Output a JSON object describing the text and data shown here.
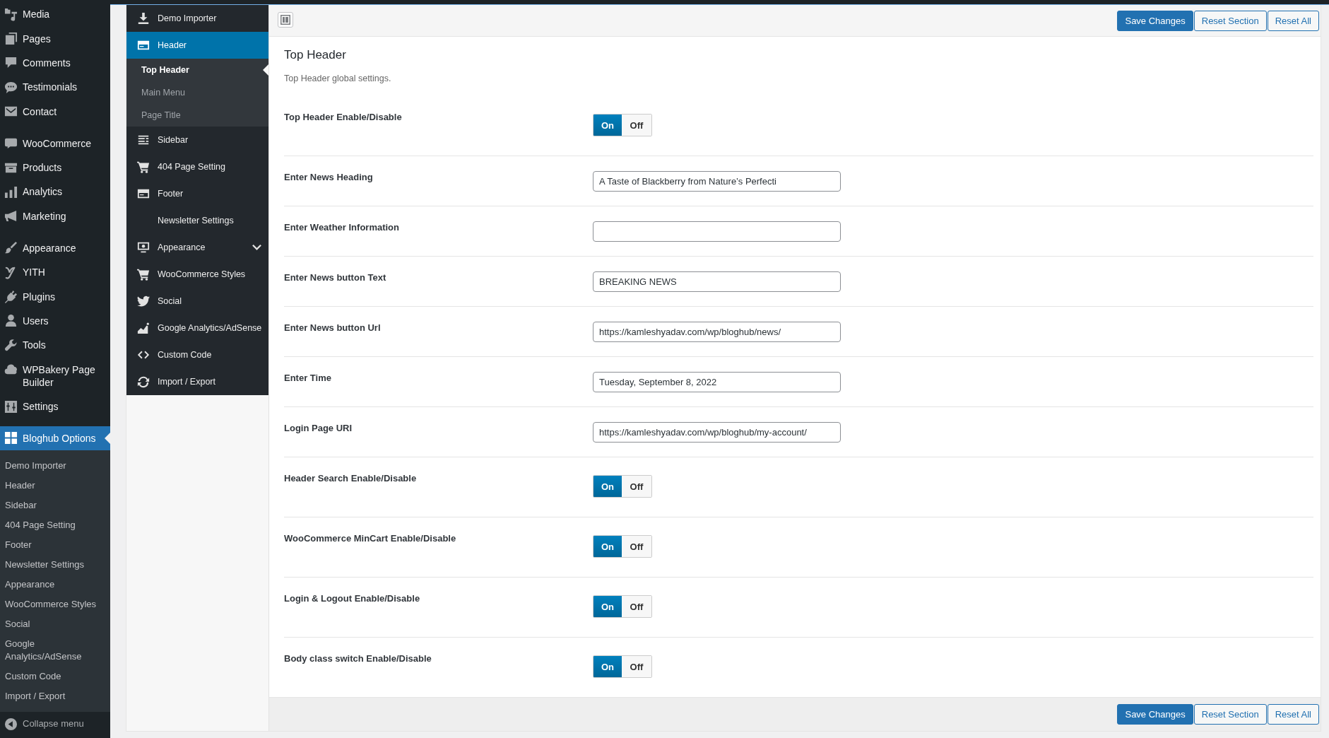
{
  "admin_menu": {
    "groups": [
      {
        "items": [
          {
            "label": "Media",
            "selected": false
          },
          {
            "label": "Pages",
            "selected": false
          },
          {
            "label": "Comments",
            "selected": false
          },
          {
            "label": "Testimonials",
            "selected": false
          },
          {
            "label": "Contact",
            "selected": false
          }
        ]
      },
      {
        "items": [
          {
            "label": "WooCommerce",
            "selected": false
          },
          {
            "label": "Products",
            "selected": false
          },
          {
            "label": "Analytics",
            "selected": false
          },
          {
            "label": "Marketing",
            "selected": false
          }
        ]
      },
      {
        "items": [
          {
            "label": "Appearance",
            "selected": false
          },
          {
            "label": "YITH",
            "selected": false
          },
          {
            "label": "Plugins",
            "selected": false
          },
          {
            "label": "Users",
            "selected": false
          },
          {
            "label": "Tools",
            "selected": false
          },
          {
            "label": "WPBakery Page Builder",
            "selected": false
          },
          {
            "label": "Settings",
            "selected": false
          }
        ]
      },
      {
        "items": [
          {
            "label": "Bloghub Options",
            "selected": true,
            "children": [
              {
                "label": "Demo Importer"
              },
              {
                "label": "Header"
              },
              {
                "label": "Sidebar"
              },
              {
                "label": "404 Page Setting"
              },
              {
                "label": "Footer"
              },
              {
                "label": "Newsletter Settings"
              },
              {
                "label": "Appearance"
              },
              {
                "label": "WooCommerce Styles"
              },
              {
                "label": "Social"
              },
              {
                "label": "Google Analytics/AdSense"
              },
              {
                "label": "Custom Code"
              },
              {
                "label": "Import / Export"
              }
            ]
          }
        ]
      }
    ],
    "collapse": {
      "label": "Collapse menu"
    }
  },
  "options_panel": {
    "toolbar": {
      "buttons": [
        {
          "label": "Save Changes",
          "kind": "primary"
        },
        {
          "label": "Reset Section",
          "kind": "secondary"
        },
        {
          "label": "Reset All",
          "kind": "secondary"
        }
      ]
    },
    "nav": {
      "items": [
        {
          "label": "Demo Importer",
          "selected": false
        },
        {
          "label": "Header",
          "selected": true,
          "expanded": true,
          "children": [
            {
              "label": "Top Header",
              "selected": true
            },
            {
              "label": "Main Menu",
              "selected": false
            },
            {
              "label": "Page Title",
              "selected": false
            }
          ]
        },
        {
          "label": "Sidebar",
          "selected": false
        },
        {
          "label": "404 Page Setting",
          "selected": false
        },
        {
          "label": "Footer",
          "selected": false
        },
        {
          "label": "Newsletter Settings",
          "selected": false
        },
        {
          "label": "Appearance",
          "selected": false,
          "expanded": false
        },
        {
          "label": "WooCommerce Styles",
          "selected": false
        },
        {
          "label": "Social",
          "selected": false
        },
        {
          "label": "Google Analytics/AdSense",
          "selected": false
        },
        {
          "label": "Custom Code",
          "selected": false
        },
        {
          "label": "Import / Export",
          "selected": false
        }
      ]
    },
    "section": {
      "title": "Top Header",
      "description": "Top Header global settings.",
      "fields": [
        {
          "kind": "switch",
          "label": "Top Header Enable/Disable",
          "on_label": "On",
          "off_label": "Off",
          "on": true
        },
        {
          "kind": "text",
          "label": "Enter News Heading",
          "value": "A Taste of Blackberry from Nature’s Perfecti"
        },
        {
          "kind": "text",
          "label": "Enter Weather Information"
        },
        {
          "kind": "text",
          "label": "Enter News button Text",
          "value": "BREAKING NEWS"
        },
        {
          "kind": "text",
          "label": "Enter News button Url",
          "value": "https://kamleshyadav.com/wp/bloghub/news/"
        },
        {
          "kind": "text",
          "label": "Enter Time",
          "value": "Tuesday, September 8, 2022"
        },
        {
          "kind": "text",
          "label": "Login Page URI",
          "value": "https://kamleshyadav.com/wp/bloghub/my-account/"
        },
        {
          "kind": "switch",
          "label": "Header Search Enable/Disable",
          "on_label": "On",
          "off_label": "Off",
          "on": true
        },
        {
          "kind": "switch",
          "label": "WooCommerce MinCart Enable/Disable",
          "on_label": "On",
          "off_label": "Off",
          "on": true
        },
        {
          "kind": "switch",
          "label": "Login & Logout Enable/Disable",
          "on_label": "On",
          "off_label": "Off",
          "on": true
        },
        {
          "kind": "switch",
          "label": "Body class switch Enable/Disable",
          "on_label": "On",
          "off_label": "Off",
          "on": true
        }
      ]
    },
    "footer": {
      "buttons": [
        {
          "label": "Save Changes",
          "kind": "primary"
        },
        {
          "label": "Reset Section",
          "kind": "secondary"
        },
        {
          "label": "Reset All",
          "kind": "secondary"
        }
      ]
    }
  }
}
